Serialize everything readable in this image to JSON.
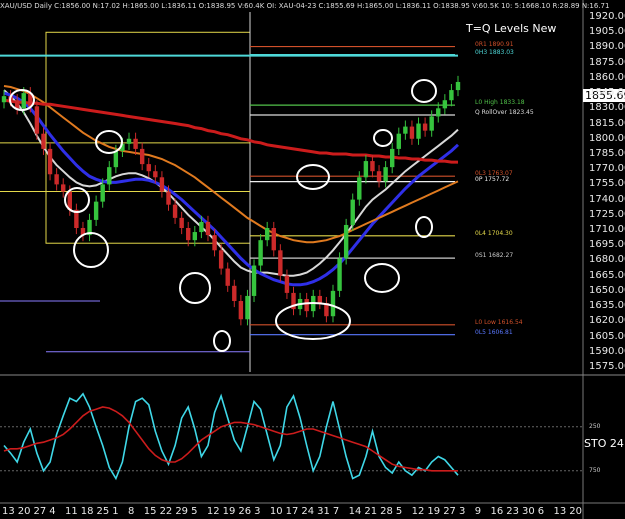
{
  "window": {
    "header": "XAU/USD Daily C:1856.00 N:17.02 H:1865.00 L:1836.11 O:1838.95 V:60.4K OI: XAU-04-23 C:1855.69 H:1865.00 L:1836.11 O:1838.95 V:60.5K 10: 5:1668.10 R:28.89 N:16.71"
  },
  "chart_data": [
    {
      "type": "candlestick",
      "title": "T=Q Levels New",
      "y_axis": {
        "ticks": [
          "1920.00",
          "1905.00",
          "1890.00",
          "1875.00",
          "1860.00",
          "1845.00",
          "1830.00",
          "1815.00",
          "1800.00",
          "1785.00",
          "1770.00",
          "1755.00",
          "1740.00",
          "1725.00",
          "1710.00",
          "1695.00",
          "1680.00",
          "1665.00",
          "1650.00",
          "1635.00",
          "1620.00",
          "1605.00",
          "1590.00",
          "1575.00"
        ],
        "range": [
          1570,
          1925
        ]
      },
      "last_price": "1855.69",
      "closes": [
        1842,
        1838,
        1830,
        1845,
        1832,
        1805,
        1790,
        1765,
        1755,
        1748,
        1730,
        1712,
        1705,
        1720,
        1738,
        1755,
        1772,
        1788,
        1795,
        1800,
        1790,
        1775,
        1768,
        1762,
        1748,
        1735,
        1722,
        1712,
        1700,
        1708,
        1718,
        1705,
        1690,
        1672,
        1655,
        1640,
        1622,
        1645,
        1675,
        1700,
        1712,
        1690,
        1665,
        1648,
        1632,
        1642,
        1630,
        1645,
        1638,
        1625,
        1650,
        1682,
        1715,
        1740,
        1762,
        1778,
        1768,
        1758,
        1772,
        1790,
        1805,
        1812,
        1800,
        1815,
        1808,
        1822,
        1830,
        1838,
        1848,
        1856
      ],
      "levels": [
        {
          "label": "0R1 1890.91",
          "value": 1890.91,
          "color": "#d0502a"
        },
        {
          "label": "0H3 1883.03",
          "value": 1883.03,
          "color": "#4ed8d8"
        },
        {
          "label": "L0 High 1833.18",
          "value": 1833.18,
          "color": "#52c24a"
        },
        {
          "label": "Q RollOver 1823.45",
          "value": 1823.45,
          "color": "#dddddd"
        },
        {
          "label": "0L3 1763.07",
          "value": 1763.07,
          "color": "#d0502a"
        },
        {
          "label": "0P 1757.72",
          "value": 1757.72,
          "color": "#eeeeee"
        },
        {
          "label": "0L4 1704.30",
          "value": 1704.3,
          "color": "#e3d84a"
        },
        {
          "label": "0S1 1682.27",
          "value": 1682.27,
          "color": "#cccccc"
        },
        {
          "label": "L0 Low 1616.54",
          "value": 1616.54,
          "color": "#d0502a"
        },
        {
          "label": "0L5 1606.81",
          "value": 1606.81,
          "color": "#5a78ff"
        }
      ],
      "moving_averages": [
        {
          "color": "#d8d8d8",
          "values": [
            1848,
            1842,
            1835,
            1826,
            1815,
            1803,
            1792,
            1782,
            1774,
            1768,
            1762,
            1757,
            1754,
            1753,
            1754,
            1757,
            1760,
            1763,
            1765,
            1766,
            1766,
            1764,
            1761,
            1757,
            1752,
            1746,
            1739,
            1732,
            1725,
            1719,
            1713,
            1707,
            1700,
            1693,
            1686,
            1679,
            1673,
            1670,
            1668,
            1668,
            1668,
            1667,
            1666,
            1665,
            1665,
            1666,
            1668,
            1672,
            1677,
            1683,
            1690,
            1698,
            1706,
            1715,
            1724,
            1733,
            1740,
            1745,
            1750,
            1756,
            1762,
            1768,
            1773,
            1778,
            1783,
            1788,
            1793,
            1798,
            1803,
            1809
          ]
        },
        {
          "color": "#2f2fe8",
          "values": [
            1845,
            1843,
            1840,
            1836,
            1830,
            1822,
            1813,
            1804,
            1796,
            1788,
            1781,
            1774,
            1768,
            1763,
            1760,
            1758,
            1757,
            1757,
            1758,
            1759,
            1760,
            1760,
            1759,
            1757,
            1754,
            1750,
            1745,
            1740,
            1734,
            1728,
            1722,
            1716,
            1710,
            1703,
            1696,
            1689,
            1682,
            1676,
            1671,
            1667,
            1664,
            1661,
            1659,
            1657,
            1656,
            1656,
            1657,
            1659,
            1662,
            1666,
            1671,
            1677,
            1684,
            1692,
            1700,
            1708,
            1716,
            1723,
            1730,
            1737,
            1744,
            1751,
            1757,
            1763,
            1768,
            1773,
            1778,
            1783,
            1788,
            1794
          ]
        },
        {
          "color": "#e07a1f",
          "values": [
            1852,
            1851,
            1849,
            1847,
            1844,
            1840,
            1836,
            1831,
            1826,
            1821,
            1816,
            1811,
            1806,
            1802,
            1798,
            1795,
            1792,
            1790,
            1788,
            1787,
            1786,
            1785,
            1784,
            1782,
            1780,
            1777,
            1774,
            1770,
            1766,
            1762,
            1757,
            1752,
            1747,
            1742,
            1737,
            1732,
            1727,
            1722,
            1718,
            1714,
            1710,
            1707,
            1704,
            1702,
            1700,
            1699,
            1698,
            1698,
            1699,
            1700,
            1702,
            1704,
            1707,
            1710,
            1713,
            1716,
            1719,
            1722,
            1725,
            1728,
            1731,
            1734,
            1737,
            1740,
            1743,
            1746,
            1749,
            1752,
            1755,
            1758
          ]
        },
        {
          "color": "#cc1c1c",
          "values": [
            1838,
            1837,
            1836,
            1836,
            1835,
            1835,
            1834,
            1834,
            1833,
            1832,
            1831,
            1830,
            1829,
            1828,
            1827,
            1826,
            1825,
            1824,
            1823,
            1822,
            1821,
            1820,
            1819,
            1818,
            1817,
            1816,
            1815,
            1814,
            1813,
            1811,
            1810,
            1808,
            1807,
            1805,
            1804,
            1802,
            1800,
            1799,
            1797,
            1796,
            1794,
            1793,
            1792,
            1791,
            1790,
            1789,
            1788,
            1787,
            1786,
            1786,
            1785,
            1785,
            1785,
            1784,
            1784,
            1784,
            1783,
            1783,
            1782,
            1782,
            1781,
            1781,
            1780,
            1780,
            1779,
            1779,
            1778,
            1778,
            1777,
            1777
          ]
        }
      ]
    },
    {
      "type": "line",
      "title": "STO",
      "label": "STO 24",
      "y_ticks": [
        "250",
        "750"
      ],
      "series": [
        {
          "color": "#3fd8e8",
          "values": [
            45,
            38,
            30,
            48,
            60,
            38,
            22,
            30,
            55,
            72,
            88,
            85,
            92,
            80,
            62,
            45,
            25,
            15,
            30,
            62,
            85,
            88,
            82,
            58,
            40,
            28,
            45,
            70,
            80,
            60,
            35,
            45,
            75,
            90,
            70,
            50,
            40,
            62,
            85,
            78,
            55,
            32,
            45,
            80,
            90,
            70,
            45,
            22,
            35,
            62,
            85,
            60,
            35,
            15,
            18,
            35,
            58,
            35,
            25,
            20,
            30,
            22,
            18,
            25,
            22,
            30,
            35,
            32,
            25,
            18
          ]
        },
        {
          "color": "#cc1c1c",
          "values": [
            40,
            42,
            42,
            43,
            45,
            47,
            48,
            50,
            52,
            55,
            60,
            66,
            72,
            76,
            78,
            80,
            79,
            76,
            72,
            66,
            58,
            50,
            42,
            36,
            32,
            30,
            30,
            33,
            38,
            44,
            50,
            54,
            58,
            62,
            64,
            66,
            66,
            65,
            64,
            62,
            60,
            58,
            56,
            55,
            56,
            58,
            60,
            60,
            58,
            56,
            54,
            52,
            50,
            48,
            46,
            44,
            40,
            36,
            32,
            28,
            26,
            25,
            24,
            23,
            23,
            22,
            22,
            22,
            22,
            22
          ]
        }
      ]
    }
  ],
  "dates": [
    "13",
    "20",
    "27",
    "4",
    "11",
    "18",
    "25",
    "1",
    "8",
    "15",
    "22",
    "29",
    "5",
    "12",
    "19",
    "26",
    "3",
    "10",
    "17",
    "24",
    "31",
    "7",
    "14",
    "21",
    "28",
    "5",
    "12",
    "19",
    "27",
    "3",
    "9",
    "16",
    "23",
    "30",
    "6",
    "13",
    "20"
  ],
  "overlay_colors": {
    "candle_up": "#36c43e",
    "candle_down": "#cc2a2a",
    "annotation_ellipse": "#ffffff",
    "box_outline": "#e3d84a"
  }
}
